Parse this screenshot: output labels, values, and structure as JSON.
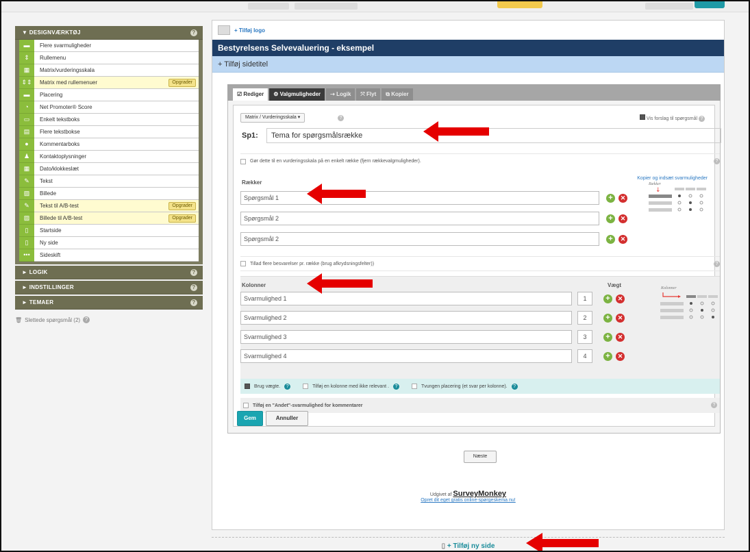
{
  "sidebar": {
    "design_header": "▼ DESIGNVÆRKTØJ",
    "tools": [
      {
        "label": "Flere svarmuligheder",
        "icon": "list-icon",
        "glyph": "▬"
      },
      {
        "label": "Rullemenu",
        "icon": "dropdown-icon",
        "glyph": "⇕"
      },
      {
        "label": "Matrix/vurderingsskala",
        "icon": "matrix-icon",
        "glyph": "▦"
      },
      {
        "label": "Matrix med rullemenuer",
        "icon": "matrix-dropdown-icon",
        "glyph": "⇕⇕",
        "upgrade": "Opgrader"
      },
      {
        "label": "Placering",
        "icon": "ranking-icon",
        "glyph": "▬"
      },
      {
        "label": "Net Promoter® Score",
        "icon": "gauge-icon",
        "glyph": "◔"
      },
      {
        "label": "Enkelt tekstboks",
        "icon": "textbox-icon",
        "glyph": "▭"
      },
      {
        "label": "Flere tekstbokse",
        "icon": "textboxes-icon",
        "glyph": "▤"
      },
      {
        "label": "Kommentarboks",
        "icon": "comment-icon",
        "glyph": "●"
      },
      {
        "label": "Kontaktoplysninger",
        "icon": "person-icon",
        "glyph": "♟"
      },
      {
        "label": "Dato/klokkeslæt",
        "icon": "calendar-icon",
        "glyph": "▦"
      },
      {
        "label": "Tekst",
        "icon": "text-edit-icon",
        "glyph": "✎"
      },
      {
        "label": "Billede",
        "icon": "image-icon",
        "glyph": "▨"
      },
      {
        "label": "Tekst til A/B-test",
        "icon": "text-ab-icon",
        "glyph": "✎",
        "upgrade": "Opgrader"
      },
      {
        "label": "Billede til A/B-test",
        "icon": "image-ab-icon",
        "glyph": "▨",
        "upgrade": "Opgrader"
      },
      {
        "label": "Startside",
        "icon": "start-page-icon",
        "glyph": "▯"
      },
      {
        "label": "Ny side",
        "icon": "new-page-icon",
        "glyph": "▯"
      },
      {
        "label": "Sideskift",
        "icon": "page-break-icon",
        "glyph": "•••"
      }
    ],
    "logic_header": "► LOGIK",
    "settings_header": "► INDSTILLINGER",
    "themes_header": "► TEMAER",
    "deleted": "Slettede spørgsmål (2)"
  },
  "page": {
    "add_logo": "+ Tilføj logo",
    "survey_title": "Bestyrelsens Selvevaluering - eksempel",
    "add_page_title": "+ Tilføj sidetitel"
  },
  "tabs": {
    "edit": "☑ Rediger",
    "options": "⚙ Valgmuligheder",
    "logic": "⇢ Logik",
    "move": "⤧ Flyt",
    "copy": "⧉ Kopier"
  },
  "question": {
    "type": "Matrix / Vurderingsskala  ▾",
    "suggest": "Vis forslag til spørgsmål",
    "number": "Sp1:",
    "text": "Tema for spørgsmålsrække",
    "single_row": "Gør dette til en vurderingsskala på en enkelt række (fjern rækkevalgmuligheder).",
    "rows_label": "Rækker",
    "copy_link": "Kopier og indsæt svarmuligheder",
    "rows": [
      "Spørgsmål 1",
      "Spørgsmål 2",
      "Spørgsmål 2"
    ],
    "multiple_answers": "Tillad flere besvarelser pr. række (brug afkrydsningsfelter))",
    "columns_label": "Kolonner",
    "weight_label": "Vægt",
    "columns": [
      {
        "label": "Svarmulighed 1",
        "weight": "1"
      },
      {
        "label": "Svarmulighed 2",
        "weight": "2"
      },
      {
        "label": "Svarmulighed 3",
        "weight": "3"
      },
      {
        "label": "Svarmulighed 4",
        "weight": "4"
      }
    ],
    "use_weights": "Brug vægte.",
    "add_na_column": "Tilføj en kolonne med ikke relevant .",
    "forced_ranking": "Tvungen placering (et svar per kolonne).",
    "add_other": "Tilføj en \"Andet\"-svarmulighed for kommentarer",
    "save": "Gem",
    "cancel": "Annuller",
    "rows_preview": "Rækker",
    "cols_preview": "Kolonner"
  },
  "next_button": "Næste",
  "footer": {
    "published_by": "Udgivet af",
    "brand": "SurveyMonkey",
    "create_link": "Opret dit eget gratis online-spørgeskema nu!"
  },
  "add_new_page": "+ Tilføj ny side",
  "colors": {
    "accent_green": "#8bbd3c",
    "navy": "#1f3e66",
    "teal": "#1aa5b1",
    "arrow_red": "#e50000"
  }
}
